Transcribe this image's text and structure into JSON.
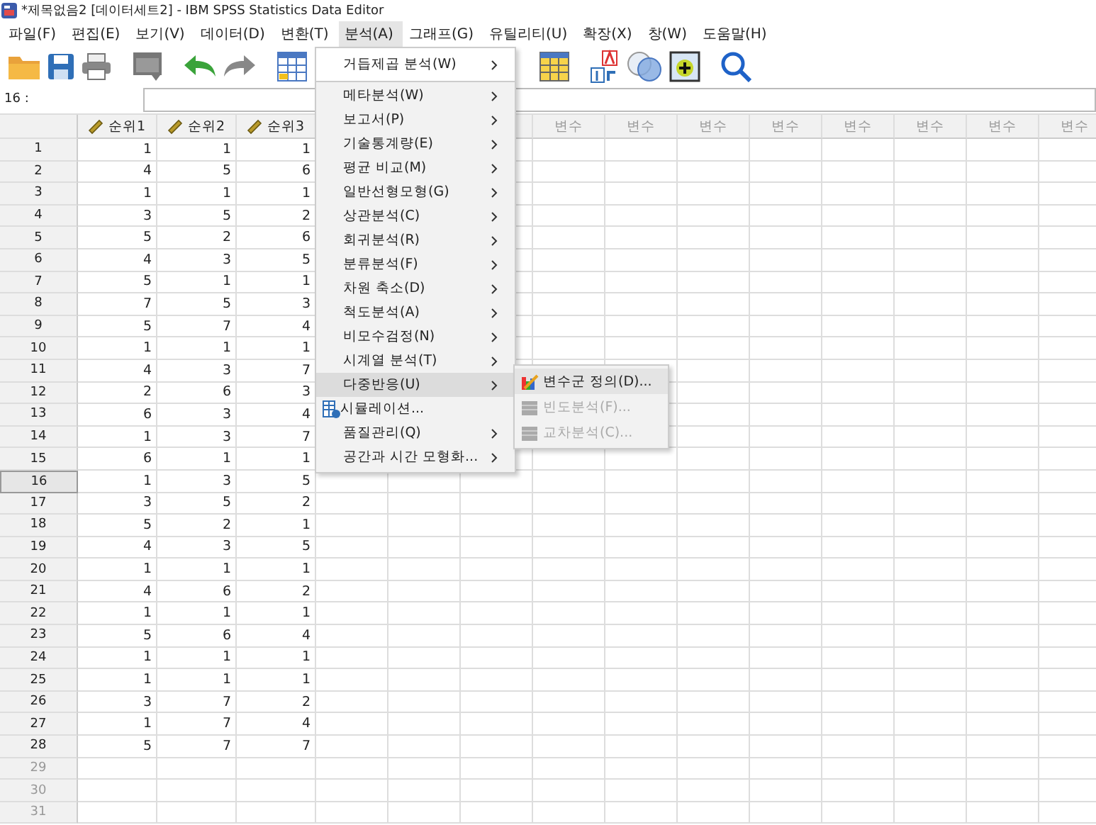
{
  "window": {
    "title": "*제목없음2 [데이터세트2] - IBM SPSS Statistics Data Editor"
  },
  "menubar": [
    {
      "label": "파일(F)",
      "selected": false
    },
    {
      "label": "편집(E)",
      "selected": false
    },
    {
      "label": "보기(V)",
      "selected": false
    },
    {
      "label": "데이터(D)",
      "selected": false
    },
    {
      "label": "변환(T)",
      "selected": false
    },
    {
      "label": "분석(A)",
      "selected": true
    },
    {
      "label": "그래프(G)",
      "selected": false
    },
    {
      "label": "유틸리티(U)",
      "selected": false
    },
    {
      "label": "확장(X)",
      "selected": false
    },
    {
      "label": "창(W)",
      "selected": false
    },
    {
      "label": "도움말(H)",
      "selected": false
    }
  ],
  "cell_editor": {
    "label": "16 :"
  },
  "grid": {
    "columns": [
      "순위1",
      "순위2",
      "순위3"
    ],
    "variable_columns": [
      "변수",
      "변수",
      "변수",
      "변수",
      "변수",
      "변수",
      "변수",
      "변수"
    ],
    "rows": [
      {
        "number": "1",
        "values": [
          "1",
          "1",
          "1"
        ],
        "selected": false,
        "empty": false
      },
      {
        "number": "2",
        "values": [
          "4",
          "5",
          "6"
        ],
        "selected": false,
        "empty": false
      },
      {
        "number": "3",
        "values": [
          "1",
          "1",
          "1"
        ],
        "selected": false,
        "empty": false
      },
      {
        "number": "4",
        "values": [
          "3",
          "5",
          "2"
        ],
        "selected": false,
        "empty": false
      },
      {
        "number": "5",
        "values": [
          "5",
          "2",
          "6"
        ],
        "selected": false,
        "empty": false
      },
      {
        "number": "6",
        "values": [
          "4",
          "3",
          "5"
        ],
        "selected": false,
        "empty": false
      },
      {
        "number": "7",
        "values": [
          "5",
          "1",
          "1"
        ],
        "selected": false,
        "empty": false
      },
      {
        "number": "8",
        "values": [
          "7",
          "5",
          "3"
        ],
        "selected": false,
        "empty": false
      },
      {
        "number": "9",
        "values": [
          "5",
          "7",
          "4"
        ],
        "selected": false,
        "empty": false
      },
      {
        "number": "10",
        "values": [
          "1",
          "1",
          "1"
        ],
        "selected": false,
        "empty": false
      },
      {
        "number": "11",
        "values": [
          "4",
          "3",
          "7"
        ],
        "selected": false,
        "empty": false
      },
      {
        "number": "12",
        "values": [
          "2",
          "6",
          "3"
        ],
        "selected": false,
        "empty": false
      },
      {
        "number": "13",
        "values": [
          "6",
          "3",
          "4"
        ],
        "selected": false,
        "empty": false
      },
      {
        "number": "14",
        "values": [
          "1",
          "3",
          "7"
        ],
        "selected": false,
        "empty": false
      },
      {
        "number": "15",
        "values": [
          "6",
          "1",
          "1"
        ],
        "selected": false,
        "empty": false
      },
      {
        "number": "16",
        "values": [
          "1",
          "3",
          "5"
        ],
        "selected": true,
        "empty": false
      },
      {
        "number": "17",
        "values": [
          "3",
          "5",
          "2"
        ],
        "selected": false,
        "empty": false
      },
      {
        "number": "18",
        "values": [
          "5",
          "2",
          "1"
        ],
        "selected": false,
        "empty": false
      },
      {
        "number": "19",
        "values": [
          "4",
          "3",
          "5"
        ],
        "selected": false,
        "empty": false
      },
      {
        "number": "20",
        "values": [
          "1",
          "1",
          "1"
        ],
        "selected": false,
        "empty": false
      },
      {
        "number": "21",
        "values": [
          "4",
          "6",
          "2"
        ],
        "selected": false,
        "empty": false
      },
      {
        "number": "22",
        "values": [
          "1",
          "1",
          "1"
        ],
        "selected": false,
        "empty": false
      },
      {
        "number": "23",
        "values": [
          "5",
          "6",
          "4"
        ],
        "selected": false,
        "empty": false
      },
      {
        "number": "24",
        "values": [
          "1",
          "1",
          "1"
        ],
        "selected": false,
        "empty": false
      },
      {
        "number": "25",
        "values": [
          "1",
          "1",
          "1"
        ],
        "selected": false,
        "empty": false
      },
      {
        "number": "26",
        "values": [
          "3",
          "7",
          "2"
        ],
        "selected": false,
        "empty": false
      },
      {
        "number": "27",
        "values": [
          "1",
          "7",
          "4"
        ],
        "selected": false,
        "empty": false
      },
      {
        "number": "28",
        "values": [
          "5",
          "7",
          "7"
        ],
        "selected": false,
        "empty": false
      },
      {
        "number": "29",
        "values": [],
        "selected": false,
        "empty": true
      },
      {
        "number": "30",
        "values": [],
        "selected": false,
        "empty": true
      },
      {
        "number": "31",
        "values": [],
        "selected": false,
        "empty": true
      }
    ]
  },
  "analyze_menu": {
    "groups": [
      [
        {
          "label": "거듭제곱 분석(W)",
          "kind": "submenu",
          "selected": false
        }
      ],
      [
        {
          "label": "메타분석(W)",
          "kind": "submenu",
          "selected": false
        },
        {
          "label": "보고서(P)",
          "kind": "submenu",
          "selected": false
        },
        {
          "label": "기술통계량(E)",
          "kind": "submenu",
          "selected": false
        },
        {
          "label": "평균 비교(M)",
          "kind": "submenu",
          "selected": false
        },
        {
          "label": "일반선형모형(G)",
          "kind": "submenu",
          "selected": false
        },
        {
          "label": "상관분석(C)",
          "kind": "submenu",
          "selected": false
        },
        {
          "label": "회귀분석(R)",
          "kind": "submenu",
          "selected": false
        },
        {
          "label": "분류분석(F)",
          "kind": "submenu",
          "selected": false
        },
        {
          "label": "차원 축소(D)",
          "kind": "submenu",
          "selected": false
        },
        {
          "label": "척도분석(A)",
          "kind": "submenu",
          "selected": false
        },
        {
          "label": "비모수검정(N)",
          "kind": "submenu",
          "selected": false
        },
        {
          "label": "시계열 분석(T)",
          "kind": "submenu",
          "selected": false
        },
        {
          "label": "다중반응(U)",
          "kind": "submenu",
          "selected": true
        },
        {
          "label": "시뮬레이션...",
          "kind": "dialog",
          "selected": false
        },
        {
          "label": "품질관리(Q)",
          "kind": "submenu",
          "selected": false
        },
        {
          "label": "공간과 시간 모형화...",
          "kind": "submenu",
          "selected": false
        }
      ]
    ]
  },
  "submenu": [
    {
      "label": "변수군 정의(D)...",
      "disabled": false
    },
    {
      "label": "빈도분석(F)...",
      "disabled": true
    },
    {
      "label": "교차분석(C)...",
      "disabled": true
    }
  ]
}
